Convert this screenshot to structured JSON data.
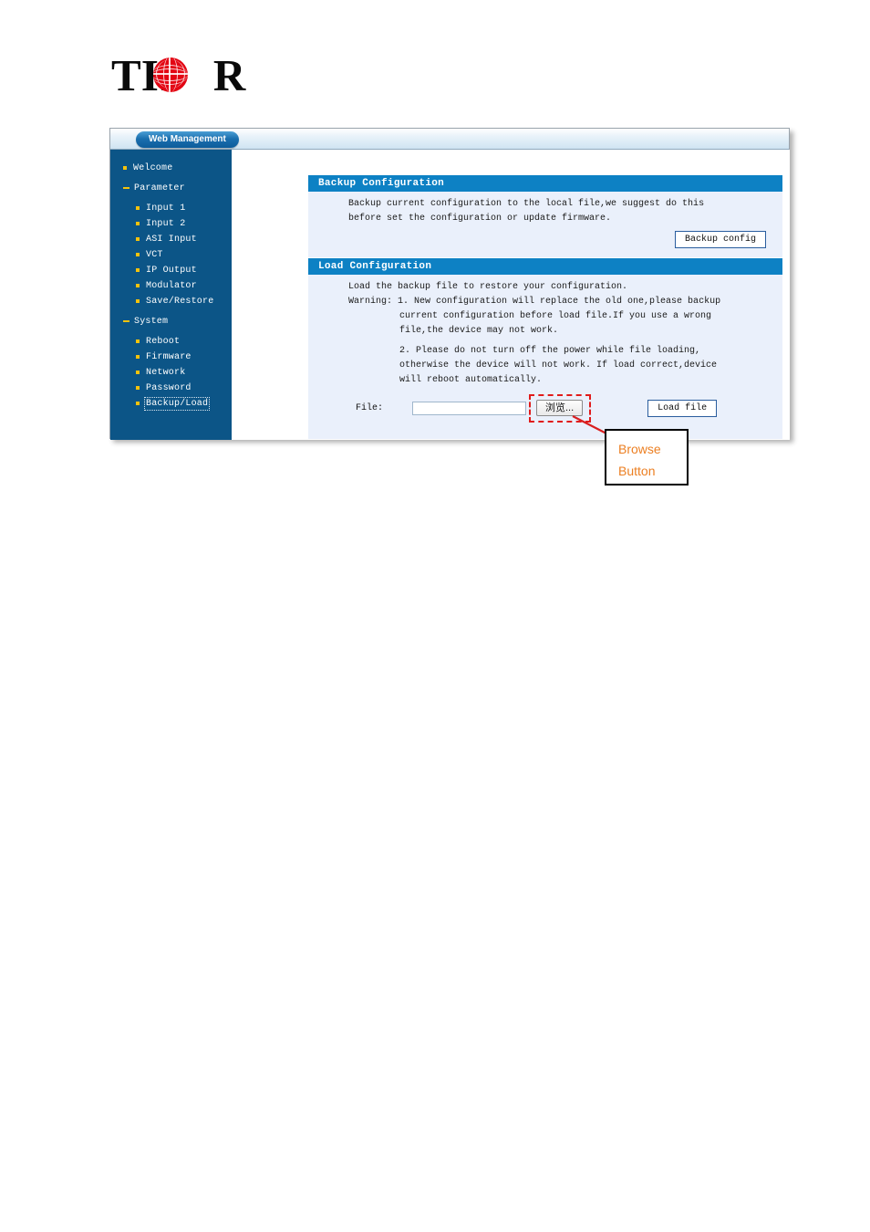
{
  "brand": {
    "logo_text_left": "TH",
    "logo_text_right": "R",
    "logo_full": "THOR",
    "globe_icon": "red-globe-icon"
  },
  "window": {
    "tab_label": "Web Management"
  },
  "sidebar": {
    "items": [
      {
        "label": "Welcome",
        "level": 1,
        "marker": "dot",
        "selected": false
      },
      {
        "label": "Parameter",
        "level": 1,
        "marker": "minus",
        "selected": false
      },
      {
        "label": "Input 1",
        "level": 2,
        "marker": "dot",
        "selected": false
      },
      {
        "label": "Input 2",
        "level": 2,
        "marker": "dot",
        "selected": false
      },
      {
        "label": "ASI Input",
        "level": 2,
        "marker": "dot",
        "selected": false
      },
      {
        "label": "VCT",
        "level": 2,
        "marker": "dot",
        "selected": false
      },
      {
        "label": "IP Output",
        "level": 2,
        "marker": "dot",
        "selected": false
      },
      {
        "label": "Modulator",
        "level": 2,
        "marker": "dot",
        "selected": false
      },
      {
        "label": "Save/Restore",
        "level": 2,
        "marker": "dot",
        "selected": false
      },
      {
        "label": "System",
        "level": 1,
        "marker": "minus",
        "selected": false
      },
      {
        "label": "Reboot",
        "level": 2,
        "marker": "dot",
        "selected": false
      },
      {
        "label": "Firmware",
        "level": 2,
        "marker": "dot",
        "selected": false
      },
      {
        "label": "Network",
        "level": 2,
        "marker": "dot",
        "selected": false
      },
      {
        "label": "Password",
        "level": 2,
        "marker": "dot",
        "selected": false
      },
      {
        "label": "Backup/Load",
        "level": 2,
        "marker": "dot",
        "selected": true
      }
    ]
  },
  "backup_panel": {
    "title": "Backup Configuration",
    "line1": "Backup current configuration to the local file,we suggest do this",
    "line2": "before set the configuration or update firmware.",
    "button_label": "Backup config"
  },
  "load_panel": {
    "title": "Load Configuration",
    "intro": "Load the backup file to restore your configuration.",
    "warning_line1": "Warning: 1. New configuration will replace the old one,please backup",
    "warning_line2": "current configuration before load file.If you use a wrong",
    "warning_line3": "file,the device may not work.",
    "warning_line4": "2. Please do not turn off the power while file loading,",
    "warning_line5": "otherwise the device will not work. If load correct,device",
    "warning_line6": "will reboot automatically.",
    "file_label": "File:",
    "file_value": "",
    "file_placeholder": "",
    "browse_label": "浏览...",
    "load_button_label": "Load file"
  },
  "annotation": {
    "line1": "Browse",
    "line2": "Button",
    "text_color": "#ec7f22",
    "highlight_color": "#e01b1b",
    "arrow_color": "#d91f1f"
  },
  "colors": {
    "sidebar_bg": "#0c5587",
    "panel_header_bg": "#0d81c4",
    "panel_body_bg": "#eaf0fb",
    "bullet": "#f4c20d",
    "tab_blue": "#0d5c9b"
  }
}
